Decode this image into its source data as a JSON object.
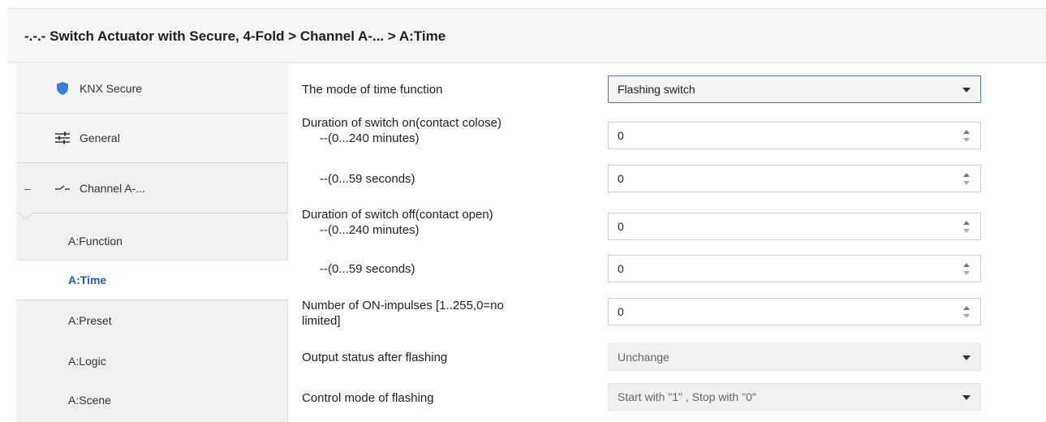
{
  "header": {
    "title": "-.-.- Switch Actuator with Secure, 4-Fold > Channel A-... >   A:Time"
  },
  "sidebar": {
    "items": [
      {
        "label": "KNX Secure",
        "icon": "shield-icon"
      },
      {
        "label": "General",
        "icon": "sliders-icon"
      },
      {
        "label": "Channel A-...",
        "icon": "switch-icon",
        "collapse": "–"
      }
    ],
    "subitems": [
      {
        "label": "A:Function"
      },
      {
        "label": "A:Time",
        "active": true
      },
      {
        "label": "A:Preset"
      },
      {
        "label": "A:Logic"
      },
      {
        "label": "A:Scene"
      }
    ]
  },
  "params": {
    "mode": {
      "label": "The mode of time function",
      "value": "Flashing switch"
    },
    "on_minutes": {
      "label_line1": "Duration of switch on(contact colose)",
      "label_line2": "--(0...240 minutes)",
      "value": "0"
    },
    "on_seconds": {
      "label": "--(0...59 seconds)",
      "value": "0"
    },
    "off_minutes": {
      "label_line1": "Duration of switch off(contact open)",
      "label_line2": "--(0...240 minutes)",
      "value": "0"
    },
    "off_seconds": {
      "label": "--(0...59 seconds)",
      "value": "0"
    },
    "impulses": {
      "label_line1": "Number of ON-impulses [1..255,0=no",
      "label_line2": "limited]",
      "value": "0"
    },
    "output_status": {
      "label": "Output status after flashing",
      "value": "Unchange"
    },
    "control_mode": {
      "label": "Control mode of flashing",
      "value": "Start with \"1\" , Stop with \"0\""
    }
  },
  "colors": {
    "accent": "#1f5fa8",
    "shield": "#3a7fd5",
    "focus_border": "#4a7bbd"
  }
}
